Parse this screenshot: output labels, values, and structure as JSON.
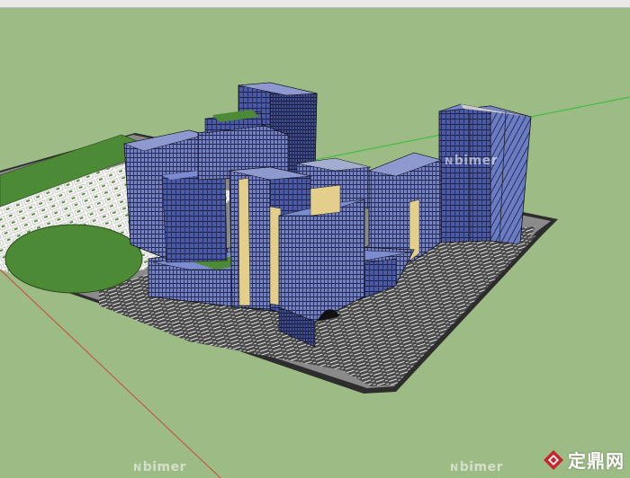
{
  "window": {
    "title": ""
  },
  "watermarks": {
    "center": "bimer",
    "bottom_left": "bimer",
    "bottom_right": "bimer"
  },
  "logo": {
    "text": "定鼎网",
    "icon": "house-diamond-icon",
    "color": "#c8262c"
  },
  "colors": {
    "sky_ground": "#9dbb85",
    "lawn": "#4d8a35",
    "building_glass": "#5b6db6",
    "building_dark": "#353a66",
    "accent_gold": "#e3cf8b",
    "axis_green": "#2fbf37",
    "axis_red": "#c94a3a"
  }
}
